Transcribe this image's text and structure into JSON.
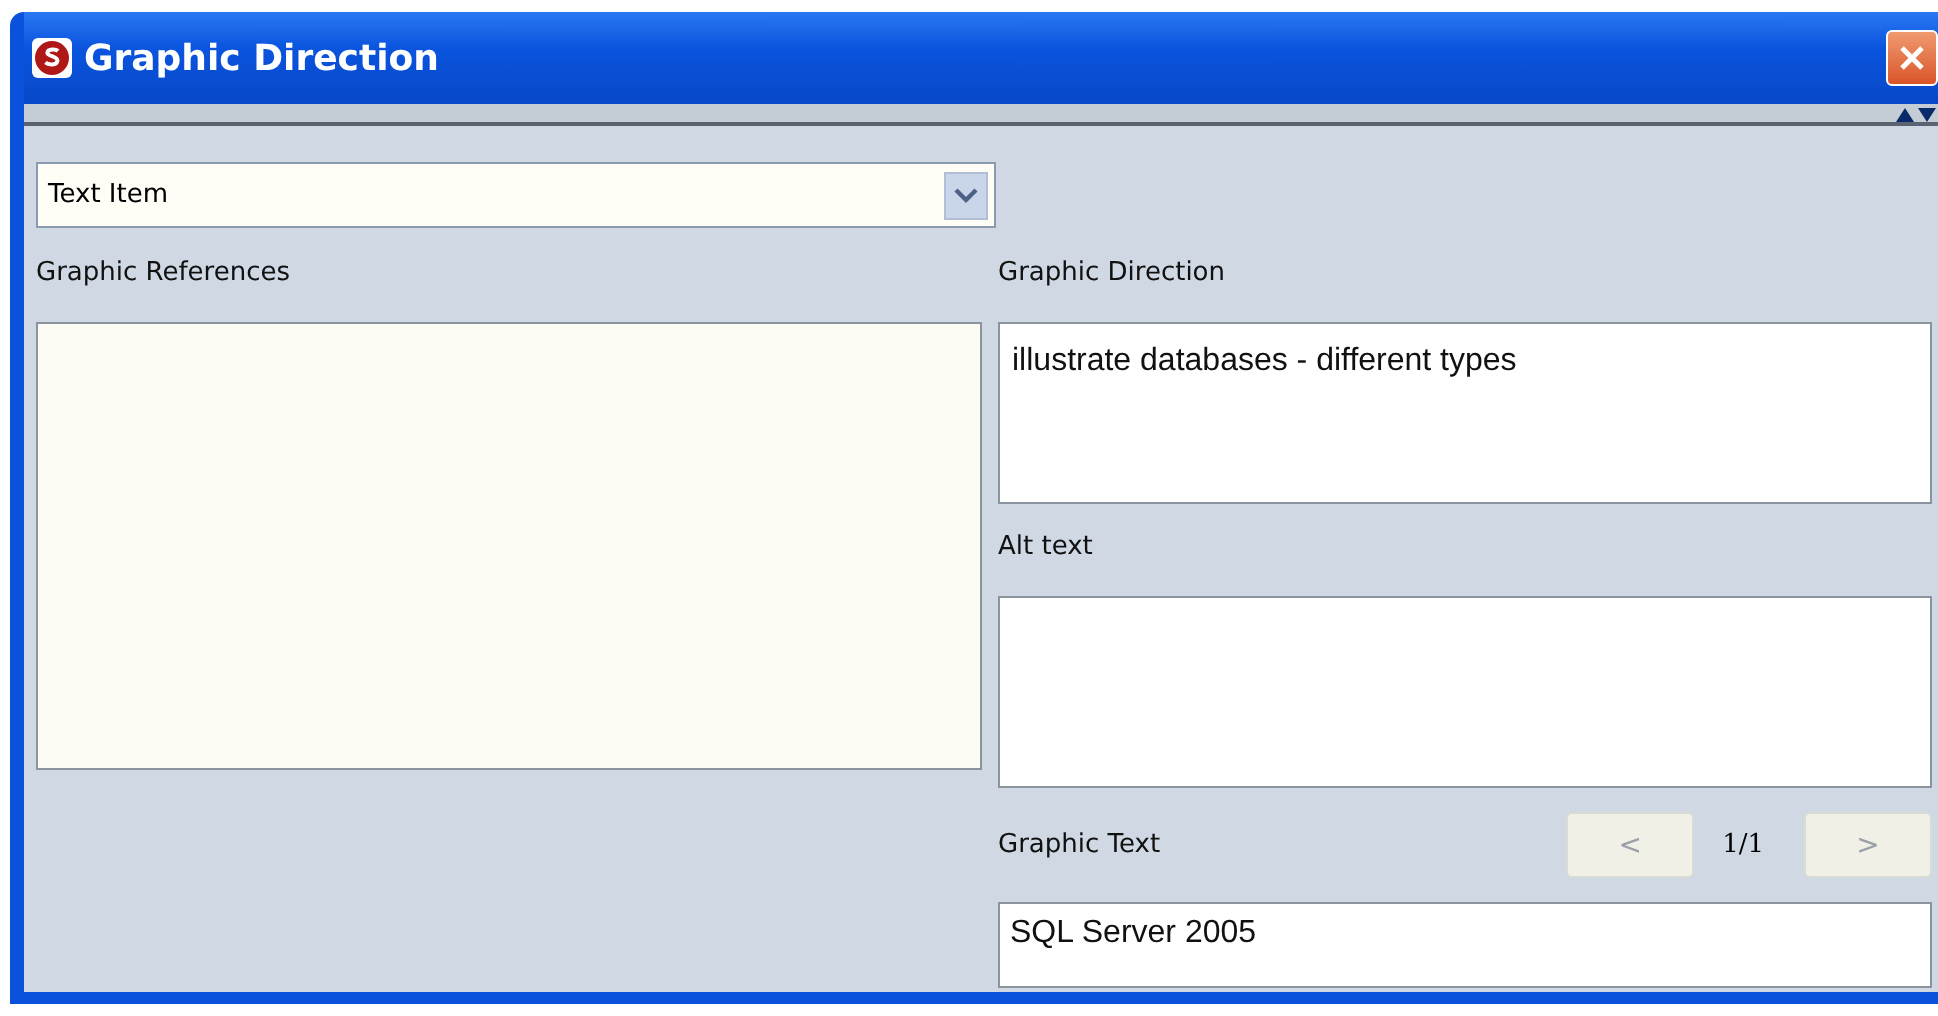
{
  "window": {
    "title": "Graphic Direction"
  },
  "type_select": {
    "value": "Text Item"
  },
  "graphic_references": {
    "label": "Graphic References"
  },
  "graphic_direction": {
    "label": "Graphic Direction",
    "value": "illustrate databases - different types"
  },
  "alt_text": {
    "label": "Alt text"
  },
  "graphic_text": {
    "label": "Graphic Text",
    "value": "SQL Server 2005"
  },
  "pager": {
    "prev": {
      "label": "<",
      "disabled": true
    },
    "count": "1/1",
    "next": {
      "label": ">",
      "disabled": true
    }
  }
}
